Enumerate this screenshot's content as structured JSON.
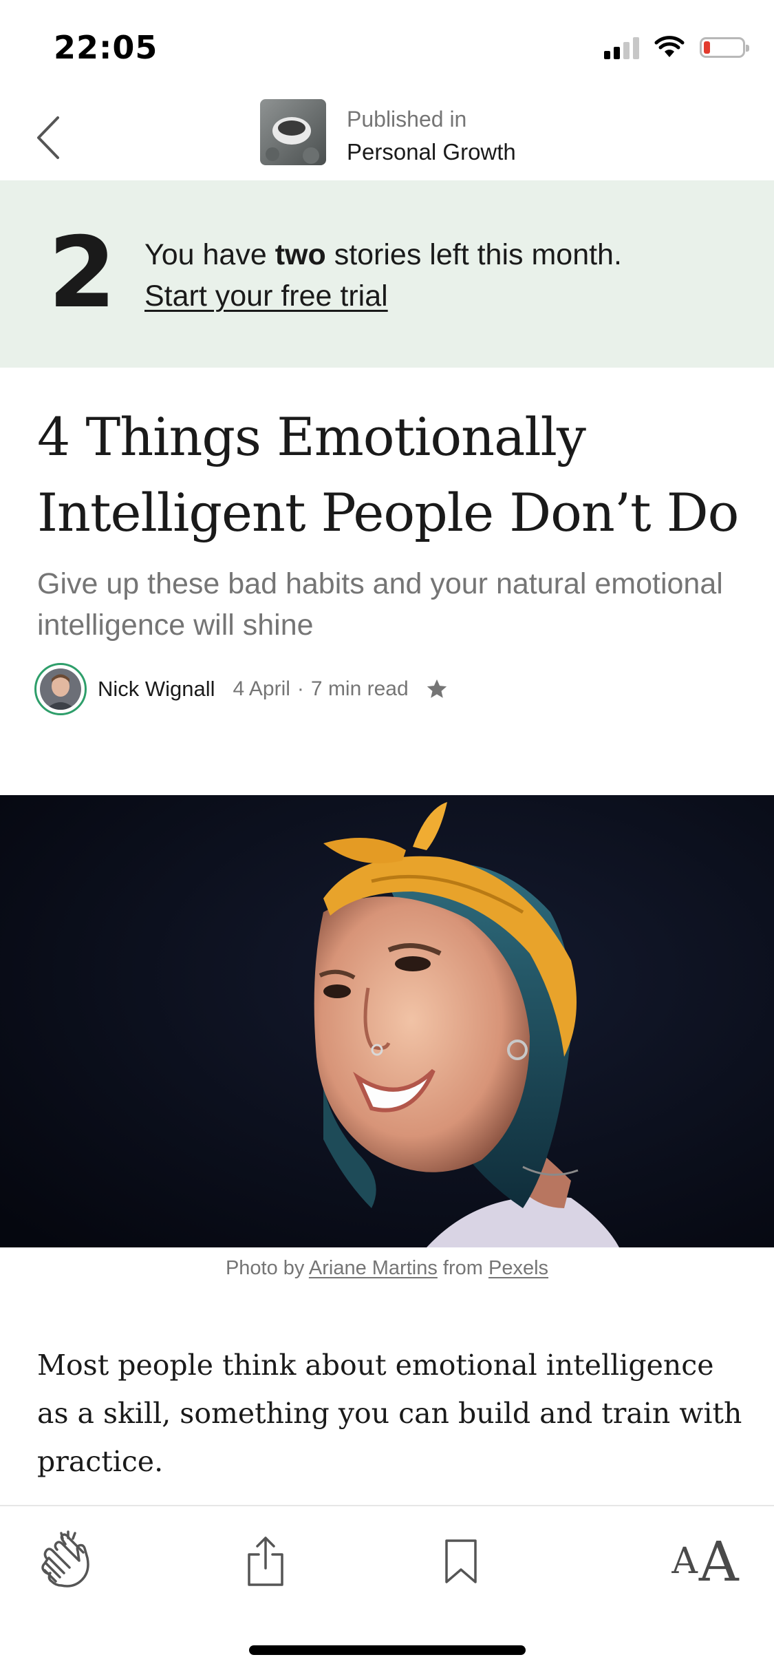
{
  "status_bar": {
    "time": "22:05"
  },
  "nav": {
    "published_label": "Published in",
    "publication_name": "Personal Growth"
  },
  "banner": {
    "count": "2",
    "message_prefix": "You have ",
    "message_bold": "two",
    "message_suffix": " stories left this month.",
    "cta": "Start your free trial"
  },
  "article": {
    "title": "4 Things Emotionally Intelligent People Don’t Do",
    "subtitle": "Give up these bad habits and your natural emotional intelligence will shine",
    "author": "Nick Wignall",
    "date": "4 April",
    "separator": "·",
    "read_time": "7 min read",
    "caption": {
      "prefix": "Photo by ",
      "photographer": "Ariane Martins",
      "middle": " from ",
      "source": "Pexels"
    },
    "body_first_paragraph": "Most people think about emotional intelligence as a skill, something you can build and train with practice."
  },
  "toolbar": {
    "font_small": "A",
    "font_large": "A"
  },
  "icons": {
    "back": "chevron-left-icon",
    "clap": "clap-icon",
    "share": "share-icon",
    "bookmark": "bookmark-icon",
    "star": "star-icon",
    "signal": "signal-icon",
    "wifi": "wifi-icon",
    "battery": "battery-icon"
  },
  "colors": {
    "banner_bg": "#e9f1ea",
    "muted_text": "#757575",
    "avatar_ring": "#2e9e6a",
    "battery_low": "#e23b2e"
  }
}
